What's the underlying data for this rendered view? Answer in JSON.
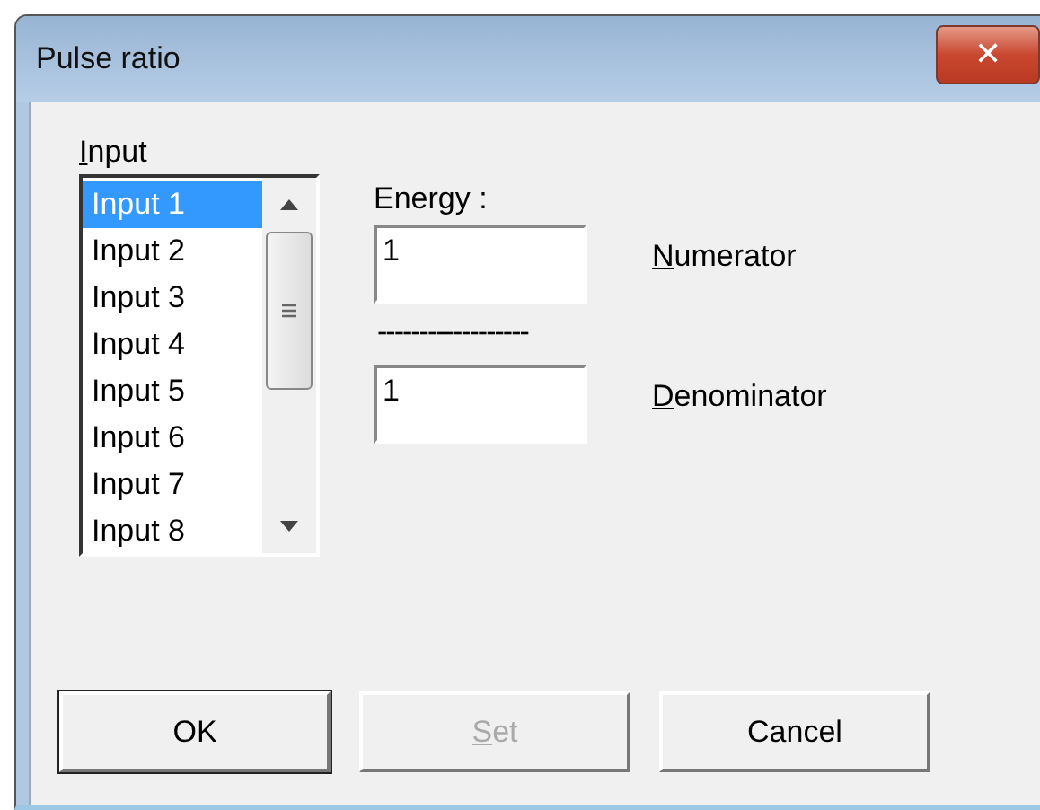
{
  "window": {
    "title": "Pulse ratio",
    "close_glyph": "✕"
  },
  "input_list": {
    "label": "Input",
    "mnemonic_underlined": true,
    "items": [
      {
        "label": "Input 1",
        "selected": true
      },
      {
        "label": "Input 2",
        "selected": false
      },
      {
        "label": "Input 3",
        "selected": false
      },
      {
        "label": "Input 4",
        "selected": false
      },
      {
        "label": "Input 5",
        "selected": false
      },
      {
        "label": "Input 6",
        "selected": false
      },
      {
        "label": "Input 7",
        "selected": false
      },
      {
        "label": "Input 8",
        "selected": false
      }
    ]
  },
  "energy": {
    "label": "Energy :",
    "numerator": {
      "value": "1",
      "label": "Numerator",
      "mnemonic_underlined": true
    },
    "divider": "------------------",
    "denominator": {
      "value": "1",
      "label": "Denominator",
      "mnemonic_underlined": true
    }
  },
  "buttons": [
    {
      "label": "OK",
      "disabled": false,
      "default": true,
      "mnemonic_underlined": false
    },
    {
      "label": "Set",
      "disabled": true,
      "default": false,
      "mnemonic_underlined": true
    },
    {
      "label": "Cancel",
      "disabled": false,
      "default": false,
      "mnemonic_underlined": false
    }
  ]
}
